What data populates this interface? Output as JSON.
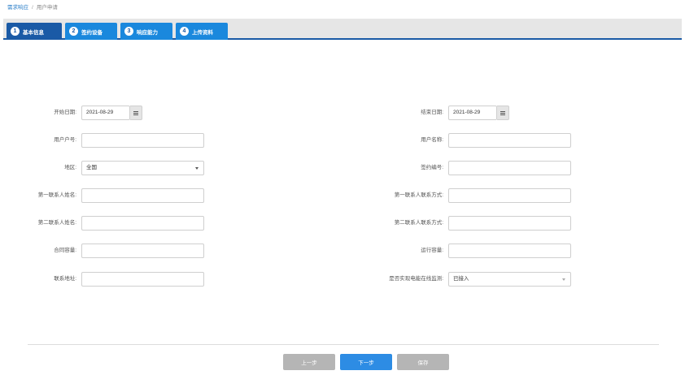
{
  "breadcrumb": {
    "parent": "需求响应",
    "current": "用户申请"
  },
  "tabs": [
    {
      "num": "1",
      "label": "基本信息"
    },
    {
      "num": "2",
      "label": "签约设备"
    },
    {
      "num": "3",
      "label": "响应能力"
    },
    {
      "num": "4",
      "label": "上传资料"
    }
  ],
  "form": {
    "start_date_label": "开始日期:",
    "start_date_value": "2021-08-29",
    "end_date_label": "结束日期:",
    "end_date_value": "2021-08-29",
    "user_account_label": "用户户号:",
    "user_account_value": "",
    "user_name_label": "用户名称:",
    "user_name_value": "",
    "region_label": "地区:",
    "region_value": "全国",
    "contract_no_label": "签约编号:",
    "contract_no_value": "",
    "contact1_name_label": "第一联系人姓名:",
    "contact1_name_value": "",
    "contact1_phone_label": "第一联系人联系方式:",
    "contact1_phone_value": "",
    "contact2_name_label": "第二联系人姓名:",
    "contact2_name_value": "",
    "contact2_phone_label": "第二联系人联系方式:",
    "contact2_phone_value": "",
    "contract_capacity_label": "合同容量:",
    "contract_capacity_value": "",
    "operating_capacity_label": "运行容量:",
    "operating_capacity_value": "",
    "address_label": "联系地址:",
    "address_value": "",
    "monitor_label": "是否实现电能在线监测:",
    "monitor_value": "已接入"
  },
  "buttons": {
    "prev": "上一步",
    "next": "下一步",
    "save": "保存"
  },
  "colors": {
    "tab_active": "#1a5aa6",
    "tab": "#1a88dd",
    "primary_button": "#2d8ce4",
    "disabled_button": "#b5b5b5"
  }
}
